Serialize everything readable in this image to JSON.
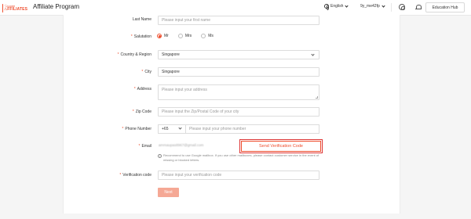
{
  "header": {
    "logo_line1": "Shopee",
    "logo_line2": "AFFILIATES",
    "title": "Affiliate Program",
    "language": "English",
    "username": "9y_me42fp",
    "education_hub": "Education Hub"
  },
  "form": {
    "last_name": {
      "label": "Last Name",
      "placeholder": "Please input your first name"
    },
    "salutation": {
      "label": "Salutation",
      "options": [
        "Mr",
        "Mrs",
        "Ms"
      ],
      "selected": "Mr"
    },
    "country": {
      "label": "Country & Region",
      "value": "Singapore"
    },
    "city": {
      "label": "City",
      "value": "Singapore"
    },
    "address": {
      "label": "Address",
      "placeholder": "Please input your address"
    },
    "zip": {
      "label": "Zip Code",
      "placeholder": "Please input the Zip/Postal Code of your city"
    },
    "phone": {
      "label": "Phone Number",
      "country_code": "+65",
      "placeholder": "Please input your phone number"
    },
    "email": {
      "label": "Email",
      "value": "ammaupas8967@gmail.com",
      "send_code": "Send Verification Code",
      "hint": "Recommend to use Google mailbox. If you use other mailboxes, please contact customer service in the event of missing or blocked letters."
    },
    "verification": {
      "label": "Verification code",
      "placeholder": "Please input your verification code"
    },
    "required_mark": "*",
    "next": "Next"
  },
  "colors": {
    "accent": "#ee4d2d",
    "next_disabled": "#f5a895"
  }
}
